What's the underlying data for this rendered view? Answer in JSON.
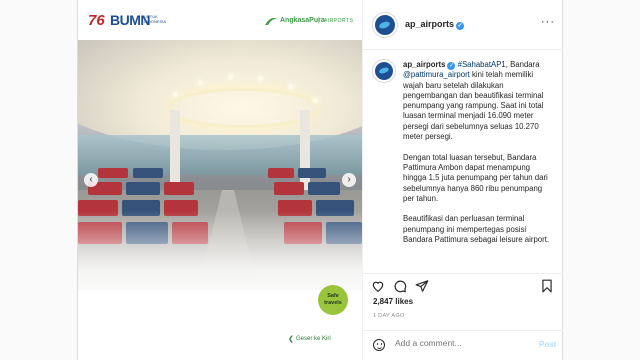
{
  "media": {
    "brand_76": "76",
    "bumn": "BUMN",
    "bumn_sub": "UNTUK INDONESIA",
    "angkasa_pura": "AngkasaPura",
    "airports": "AIRPORTS",
    "safe_travels": "Safe travels",
    "geser": "Geser ke Kiri",
    "prev_icon": "chevron-left-icon",
    "next_icon": "chevron-right-icon"
  },
  "post": {
    "username": "ap_airports",
    "verified_glyph": "✓",
    "more_glyph": "···",
    "caption": {
      "username": "ap_airports",
      "hashtag": "#SahabatAP1",
      "p1_a": ", Bandara ",
      "mention": "@pattimura_airport",
      "p1_b": " kini telah memiliki wajah baru setelah dilakukan pengembangan dan beautifikasi terminal penumpang yang rampung. Saat ini total luasan terminal menjadi 16.090 meter persegi dari sebelumnya seluas 10.270 meter persegi.",
      "p2": "Dengan total luasan tersebut, Bandara Pattimura Ambon dapat menampung hingga 1,5 juta penumpang per tahun dari sebelumnya hanya 860 ribu penumpang per tahun.",
      "p3": "Beautifikasi dan perluasan terminal penumpang ini mempertegas posisi Bandara Pattimura  sebagai leisure airport."
    },
    "likes": "2,847 likes",
    "time_ago": "1 DAY AGO",
    "comment_placeholder": "Add a comment...",
    "post_label": "Post"
  },
  "colors": {
    "accent": "#3897f0",
    "brand_green": "#3a9b46",
    "brand_blue": "#1d4f91"
  }
}
